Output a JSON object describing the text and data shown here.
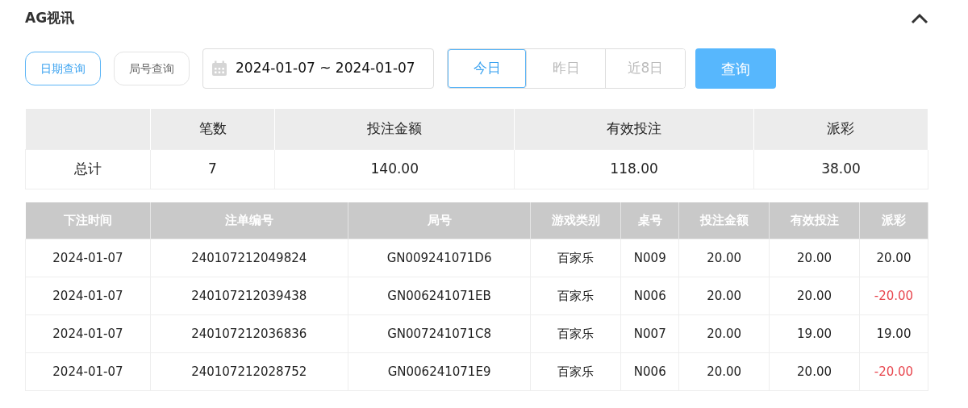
{
  "title": "AG视讯",
  "expanded": true,
  "modes": [
    {
      "label": "日期查询",
      "selected": true
    },
    {
      "label": "局号查询",
      "selected": false
    }
  ],
  "date_range": {
    "value": "2024-01-07 ~ 2024-01-07"
  },
  "quick_dates": [
    {
      "label": "今日",
      "selected": true
    },
    {
      "label": "昨日",
      "selected": false
    },
    {
      "label": "近8日",
      "selected": false
    }
  ],
  "search_button": "查询",
  "summary": {
    "columns": [
      "",
      "笔数",
      "投注金额",
      "有效投注",
      "派彩"
    ],
    "rows": [
      [
        "总计",
        "7",
        "140.00",
        "118.00",
        "38.00"
      ]
    ]
  },
  "table": {
    "columns": [
      "下注时间",
      "注单编号",
      "局号",
      "游戏类别",
      "桌号",
      "投注金额",
      "有效投注",
      "派彩"
    ],
    "rows": [
      {
        "cells": [
          "2024-01-07",
          "240107212049824",
          "GN009241071D6",
          "百家乐",
          "N009",
          "20.00",
          "20.00",
          "20.00"
        ],
        "loss": false
      },
      {
        "cells": [
          "2024-01-07",
          "240107212039438",
          "GN006241071EB",
          "百家乐",
          "N006",
          "20.00",
          "20.00",
          "-20.00"
        ],
        "loss": true
      },
      {
        "cells": [
          "2024-01-07",
          "240107212036836",
          "GN007241071C8",
          "百家乐",
          "N007",
          "20.00",
          "19.00",
          "19.00"
        ],
        "loss": false
      },
      {
        "cells": [
          "2024-01-07",
          "240107212028752",
          "GN006241071E9",
          "百家乐",
          "N006",
          "20.00",
          "20.00",
          "-20.00"
        ],
        "loss": true
      }
    ]
  }
}
